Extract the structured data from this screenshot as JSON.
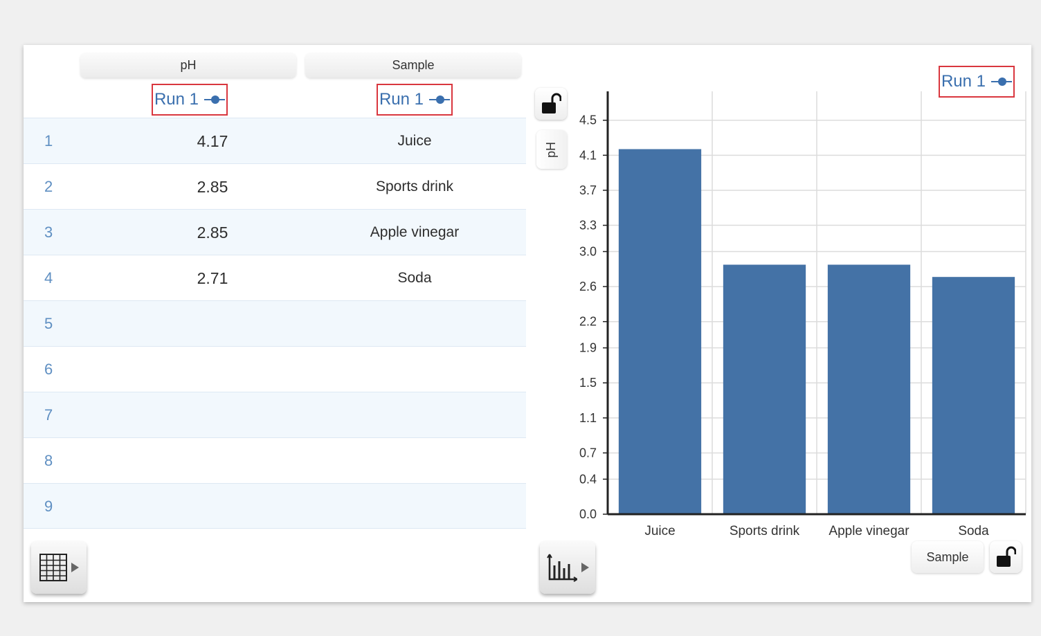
{
  "table": {
    "columns": [
      {
        "header": "pH",
        "run": "Run 1"
      },
      {
        "header": "Sample",
        "run": "Run 1"
      }
    ],
    "rows": [
      {
        "index": "1",
        "ph": "4.17",
        "sample": "Juice"
      },
      {
        "index": "2",
        "ph": "2.85",
        "sample": "Sports drink"
      },
      {
        "index": "3",
        "ph": "2.85",
        "sample": "Apple vinegar"
      },
      {
        "index": "4",
        "ph": "2.71",
        "sample": "Soda"
      },
      {
        "index": "5",
        "ph": "",
        "sample": ""
      },
      {
        "index": "6",
        "ph": "",
        "sample": ""
      },
      {
        "index": "7",
        "ph": "",
        "sample": ""
      },
      {
        "index": "8",
        "ph": "",
        "sample": ""
      },
      {
        "index": "9",
        "ph": "",
        "sample": ""
      }
    ]
  },
  "graph": {
    "legend_run": "Run 1",
    "y_axis_button": "pH",
    "x_axis_button": "Sample"
  },
  "icons": {
    "table_tool": "table-grid-icon",
    "graph_tool": "bar-graph-icon",
    "y_lock": "unlocked-padlock-icon",
    "x_lock": "unlocked-padlock-icon",
    "run_marker": "line-dot-marker-icon"
  },
  "colors": {
    "bar": "#4472a6",
    "run_text": "#3a6fae",
    "highlight_box": "#d9363e",
    "row_index": "#5f8fc2"
  },
  "chart_data": {
    "type": "bar",
    "categories": [
      "Juice",
      "Sports drink",
      "Apple vinegar",
      "Soda"
    ],
    "series": [
      {
        "name": "Run 1",
        "values": [
          4.17,
          2.85,
          2.85,
          2.71
        ]
      }
    ],
    "xlabel": "Sample",
    "ylabel": "pH",
    "ylim": [
      0.0,
      4.83
    ],
    "yticks": [
      "0.0",
      "0.4",
      "0.7",
      "1.1",
      "1.5",
      "1.9",
      "2.2",
      "2.6",
      "3.0",
      "3.3",
      "3.7",
      "4.1",
      "4.5"
    ],
    "grid": true,
    "legend": "top-right"
  }
}
